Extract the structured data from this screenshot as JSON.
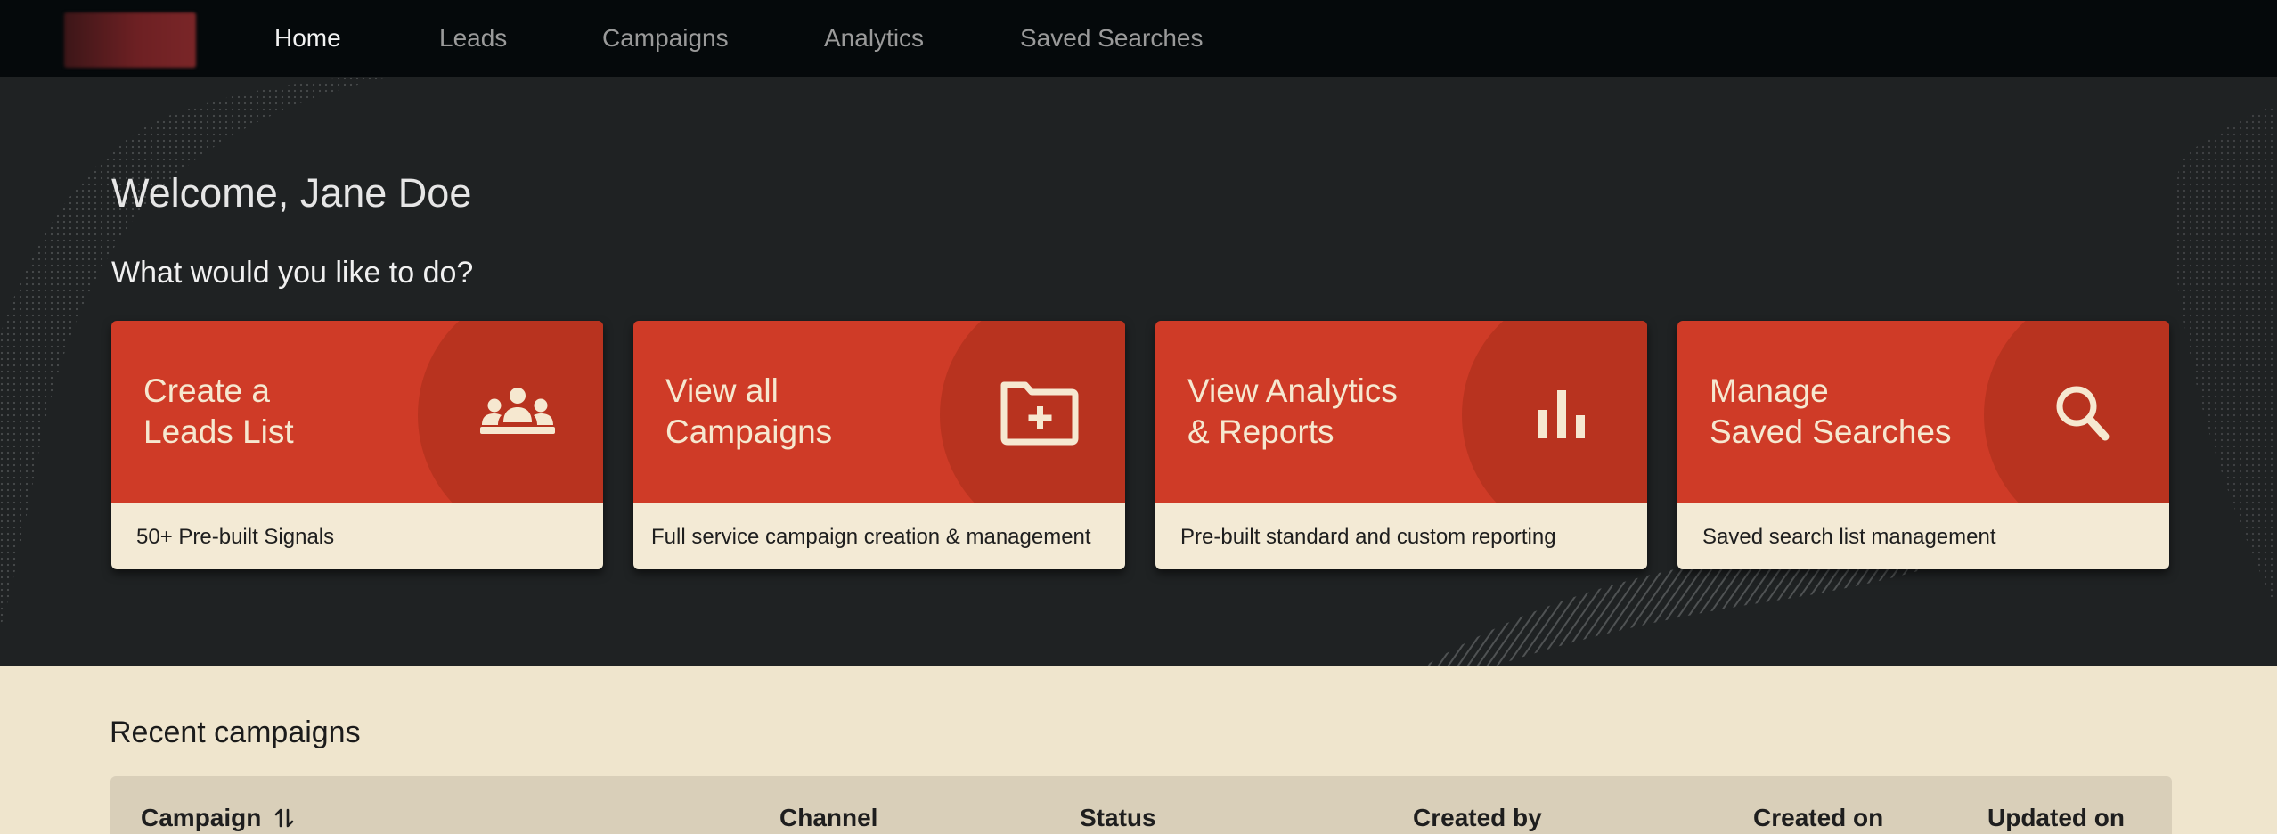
{
  "nav": {
    "logo": "logo",
    "items": [
      {
        "label": "Home",
        "active": true
      },
      {
        "label": "Leads",
        "active": false
      },
      {
        "label": "Campaigns",
        "active": false
      },
      {
        "label": "Analytics",
        "active": false
      },
      {
        "label": "Saved Searches",
        "active": false
      }
    ]
  },
  "hero": {
    "welcome": "Welcome, Jane Doe",
    "prompt": "What would you like to do?"
  },
  "cards": [
    {
      "line1": "Create a",
      "line2": "Leads List",
      "subtitle": "50+ Pre-built Signals",
      "icon": "people-group-icon"
    },
    {
      "line1": "View all",
      "line2": "Campaigns",
      "subtitle": "Full service campaign creation & management",
      "icon": "folder-plus-icon"
    },
    {
      "line1": "View Analytics",
      "line2": "& Reports",
      "subtitle": "Pre-built standard and custom reporting",
      "icon": "bar-chart-icon"
    },
    {
      "line1": "Manage",
      "line2": "Saved Searches",
      "subtitle": "Saved search list management",
      "icon": "search-icon"
    }
  ],
  "recent": {
    "title": "Recent campaigns",
    "columns": [
      "Campaign",
      "Channel",
      "Status",
      "Created by",
      "Created on",
      "Updated on"
    ]
  },
  "colors": {
    "nav_bg": "#05090b",
    "hero_bg": "#1f2223",
    "card_red": "#cf3b27",
    "card_circle": "#b8331f",
    "card_cream": "#f3ead5",
    "page_bg": "#efe5cd",
    "table_header_bg": "#d9cfb9"
  }
}
